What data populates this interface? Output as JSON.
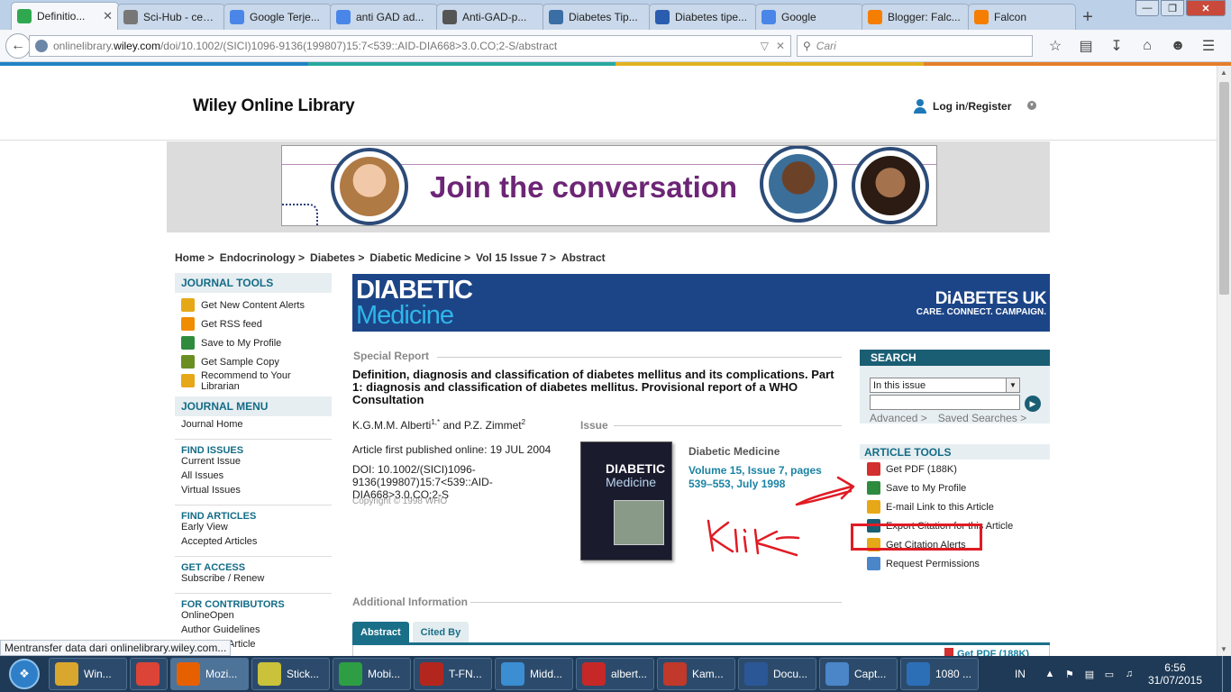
{
  "browser": {
    "tabs": [
      {
        "label": "Definitio...",
        "icon_color": "#2fa84f",
        "active": true
      },
      {
        "label": "Sci-Hub - серви...",
        "icon_color": "#777777",
        "active": false
      },
      {
        "label": "Google Terje...",
        "icon_color": "#4a86e8",
        "active": false
      },
      {
        "label": "anti GAD ad...",
        "icon_color": "#4a86e8",
        "active": false
      },
      {
        "label": "Anti-GAD-p...",
        "icon_color": "#555555",
        "active": false
      },
      {
        "label": "Diabetes Tip...",
        "icon_color": "#3a6ea5",
        "active": false
      },
      {
        "label": "Diabetes tipe...",
        "icon_color": "#2a5db0",
        "active": false
      },
      {
        "label": "Google",
        "icon_color": "#4a86e8",
        "active": false
      },
      {
        "label": "Blogger: Falc...",
        "icon_color": "#f57d00",
        "active": false
      },
      {
        "label": "Falcon",
        "icon_color": "#f57d00",
        "active": false
      }
    ],
    "new_tab_label": "+",
    "url_domain_pre": "onlinelibrary.",
    "url_domain": "wiley.com",
    "url_path": "/doi/10.1002/(SICI)1096-9136(199807)15:7<539::AID-DIA668>3.0.CO;2-S/abstract",
    "search_placeholder": "Cari",
    "status_text": "Mentransfer data dari onlinelibrary.wiley.com..."
  },
  "site": {
    "logo": "Wiley Online Library",
    "login_label": "Log in",
    "register_label": "Register",
    "login_sep": " / "
  },
  "banner": {
    "title": "Join the conversation"
  },
  "breadcrumb": [
    "Home >",
    "Endocrinology >",
    "Diabetes >",
    "Diabetic Medicine >",
    "Vol 15 Issue 7 >",
    "Abstract"
  ],
  "sidebar": {
    "journal_tools_head": "JOURNAL TOOLS",
    "journal_tools": [
      {
        "label": "Get New Content Alerts",
        "icon": "bell-icon",
        "color": "#e6a817"
      },
      {
        "label": "Get RSS feed",
        "icon": "rss-icon",
        "color": "#f08c00"
      },
      {
        "label": "Save to My Profile",
        "icon": "plus-icon",
        "color": "#2e8b3e"
      },
      {
        "label": "Get Sample Copy",
        "icon": "sample-copy-icon",
        "color": "#6b8e23"
      },
      {
        "label": "Recommend to Your Librarian",
        "icon": "envelope-icon",
        "color": "#e6a817"
      }
    ],
    "journal_menu_head": "JOURNAL MENU",
    "journal_home": "Journal Home",
    "find_issues_head": "FIND ISSUES",
    "find_issues": [
      "Current Issue",
      "All Issues",
      "Virtual Issues"
    ],
    "find_articles_head": "FIND ARTICLES",
    "find_articles": [
      "Early View",
      "Accepted Articles"
    ],
    "get_access_head": "GET ACCESS",
    "get_access": [
      "Subscribe / Renew"
    ],
    "contributors_head": "FOR CONTRIBUTORS",
    "contributors": [
      "OnlineOpen",
      "Author Guidelines",
      "Submit an Article"
    ]
  },
  "journal_banner": {
    "line1": "DIABETIC",
    "line2": "Medicine",
    "partner": "DiABETES UK",
    "partner_tag": "CARE. CONNECT. CAMPAIGN."
  },
  "article": {
    "section": "Special Report",
    "title": "Definition, diagnosis and classification of diabetes mellitus and its complications. Part 1: diagnosis and classification of diabetes mellitus. Provisional report of a WHO Consultation",
    "author1": "K.G.M.M. Alberti",
    "author1_sup": "1,*",
    "author_and": " and ",
    "author2": "P.Z. Zimmet",
    "author2_sup": "2",
    "published": "Article first published online: 19 JUL 2004",
    "doi": "DOI: 10.1002/(SICI)1096-9136(199807)15:7<539::AID-DIA668>3.0.CO;2-S",
    "copyright": "Copyright © 1998 WHO",
    "issue_label": "Issue",
    "cover_line1": "DIABETIC",
    "cover_line2": "Medicine",
    "issue_journal": "Diabetic Medicine",
    "issue_volume": "Volume 15, Issue 7, pages 539–553, July 1998",
    "additional_info": "Additional Information"
  },
  "search_panel": {
    "head": "SEARCH",
    "scope": "In this issue",
    "advanced": "Advanced >",
    "saved": "Saved Searches >"
  },
  "article_tools": {
    "head": "ARTICLE TOOLS",
    "items": [
      {
        "label": "Get PDF (188K)",
        "icon": "pdf-icon",
        "color": "#d32f2f"
      },
      {
        "label": "Save to My Profile",
        "icon": "plus-icon",
        "color": "#2e8b3e"
      },
      {
        "label": "E-mail Link to this Article",
        "icon": "envelope-icon",
        "color": "#e6a817"
      },
      {
        "label": "Export Citation for this Article",
        "icon": "quote-icon",
        "color": "#1a5e74"
      },
      {
        "label": "Get Citation Alerts",
        "icon": "alert-plus-icon",
        "color": "#e6a817"
      },
      {
        "label": "Request Permissions",
        "icon": "permissions-icon",
        "color": "#4a86c8"
      }
    ]
  },
  "bottom_tabs": [
    "Abstract",
    "Cited By"
  ],
  "bottom_pdf_peek": "Get PDF (188K)",
  "annotation": {
    "handwriting": "klik",
    "color": "#e01b24"
  },
  "taskbar": {
    "items": [
      {
        "label": "Win...",
        "icon": "folder-icon",
        "color": "#d9a62e"
      },
      {
        "label": "",
        "icon": "chrome-icon",
        "color": "#db4437"
      },
      {
        "label": "Mozi...",
        "icon": "firefox-icon",
        "color": "#e66000"
      },
      {
        "label": "Stick...",
        "icon": "sticky-notes-icon",
        "color": "#c9c23a"
      },
      {
        "label": "Mobi...",
        "icon": "mobile-icon",
        "color": "#2e9e44"
      },
      {
        "label": "T-FN...",
        "icon": "fornesia-icon",
        "color": "#b3261e"
      },
      {
        "label": "Midd...",
        "icon": "middleware-icon",
        "color": "#3a8ed1"
      },
      {
        "label": "albert...",
        "icon": "pdf-icon",
        "color": "#c62828"
      },
      {
        "label": "Kam...",
        "icon": "dictionary-icon",
        "color": "#c0392b"
      },
      {
        "label": "Docu...",
        "icon": "word-icon",
        "color": "#2b5797"
      },
      {
        "label": "Capt...",
        "icon": "capture-icon",
        "color": "#4a86c8"
      },
      {
        "label": "1080 ...",
        "icon": "player-icon",
        "color": "#2d6fb7"
      }
    ],
    "language": "IN",
    "time": "6:56",
    "date": "31/07/2015"
  }
}
